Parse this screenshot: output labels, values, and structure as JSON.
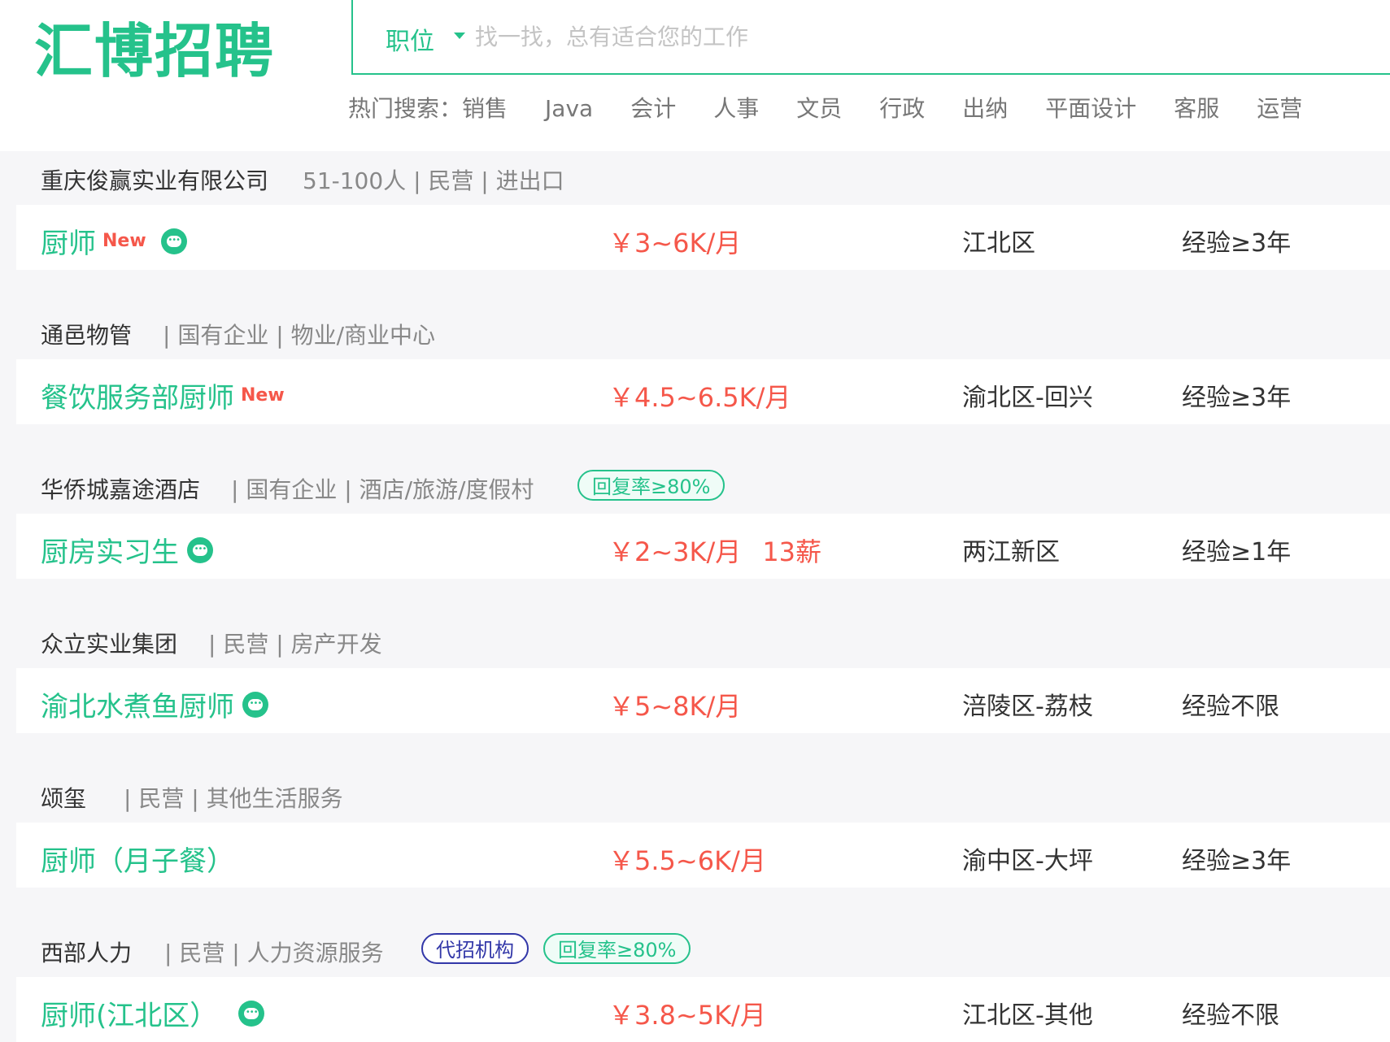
{
  "brand": {
    "logo_text": "汇博招聘"
  },
  "search": {
    "type_label": "职位",
    "placeholder": "找一找，总有适合您的工作",
    "value": ""
  },
  "hot_search": {
    "label": "热门搜索：",
    "links": [
      "销售",
      "Java",
      "会计",
      "人事",
      "文员",
      "行政",
      "出纳",
      "平面设计",
      "客服",
      "运营"
    ]
  },
  "colors": {
    "brand": "#25c28b",
    "salary": "#f5574a",
    "agency": "#3237a8"
  },
  "jobs": [
    {
      "company": "重庆俊赢实业有限公司",
      "meta": "51-100人 | 民营 | 进出口",
      "title": "厨师",
      "new_tag": "New",
      "salary": "￥3~6K/月",
      "bonus": "",
      "location": "江北区",
      "experience": "经验≥3年"
    },
    {
      "company": "通邑物管",
      "meta": "| 国有企业 | 物业/商业中心",
      "title": "餐饮服务部厨师",
      "new_tag": "New",
      "salary": "￥4.5~6.5K/月",
      "bonus": "",
      "location": "渝北区-回兴",
      "experience": "经验≥3年"
    },
    {
      "company": "华侨城嘉途酒店",
      "meta": "| 国有企业 | 酒店/旅游/度假村",
      "badge_reply": "回复率≥80%",
      "title": "厨房实习生",
      "salary": "￥2~3K/月",
      "bonus": "13薪",
      "location": "两江新区",
      "experience": "经验≥1年"
    },
    {
      "company": "众立实业集团",
      "meta": "| 民营 | 房产开发",
      "title": "渝北水煮鱼厨师",
      "salary": "￥5~8K/月",
      "bonus": "",
      "location": "涪陵区-荔枝",
      "experience": "经验不限"
    },
    {
      "company": "颂玺",
      "meta": "| 民营 | 其他生活服务",
      "title": "厨师（月子餐）",
      "salary": "￥5.5~6K/月",
      "bonus": "",
      "location": "渝中区-大坪",
      "experience": "经验≥3年"
    },
    {
      "company": "西部人力",
      "meta": "| 民营 | 人力资源服务",
      "badge_agency": "代招机构",
      "badge_reply": "回复率≥80%",
      "title": "厨师(江北区）",
      "salary": "￥3.8~5K/月",
      "bonus": "",
      "location": "江北区-其他",
      "experience": "经验不限"
    }
  ]
}
